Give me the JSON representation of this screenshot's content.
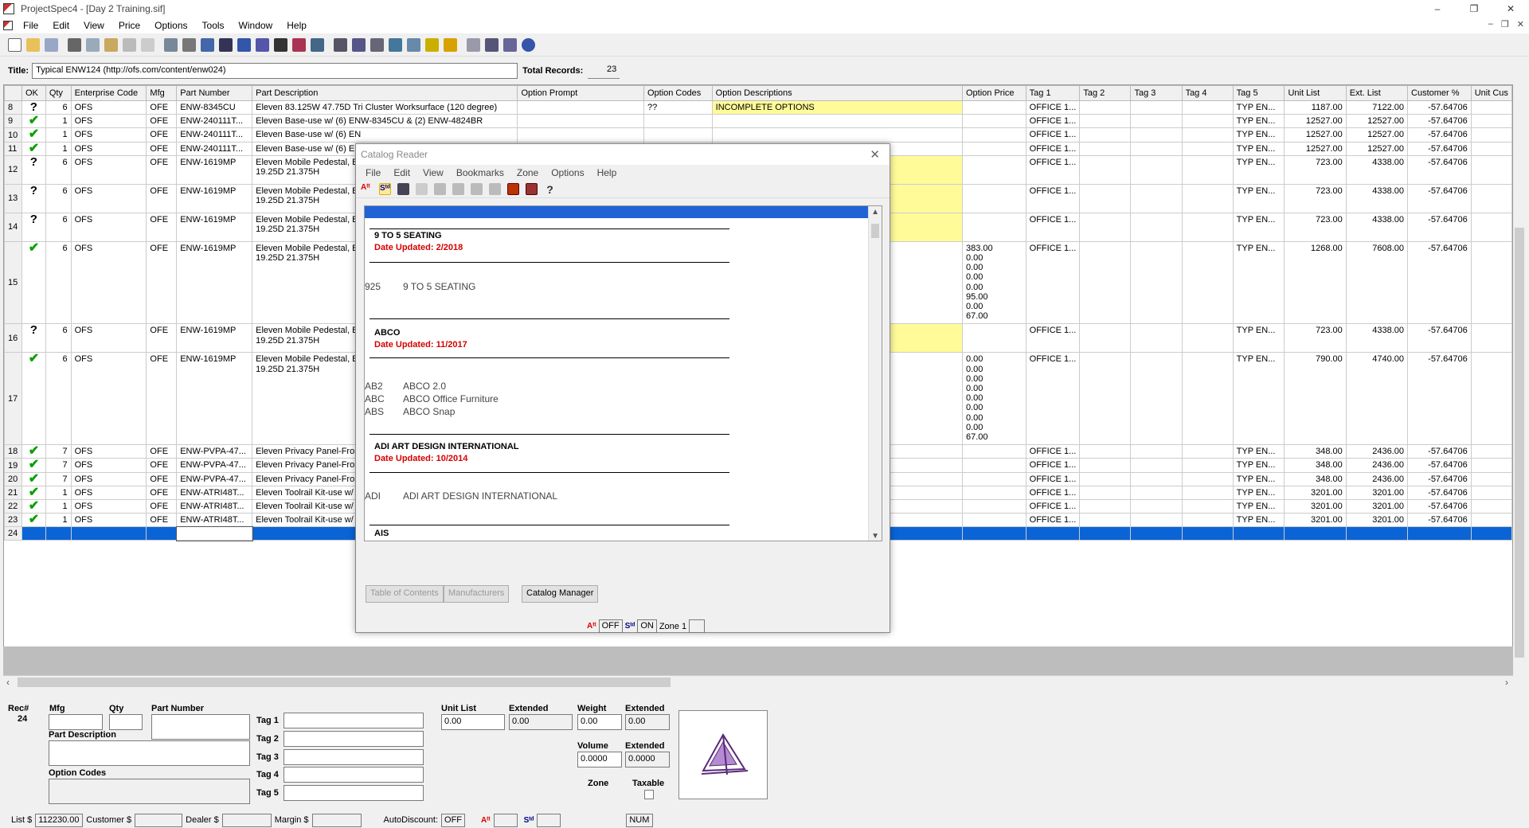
{
  "window": {
    "title": "ProjectSpec4 - [Day 2 Training.sif]",
    "min": "–",
    "restore": "❐",
    "close": "✕"
  },
  "menu": [
    "File",
    "Edit",
    "View",
    "Price",
    "Options",
    "Tools",
    "Window",
    "Help"
  ],
  "mdi_controls": [
    "–",
    "❐",
    "✕"
  ],
  "title_row": {
    "label": "Title:",
    "value": "Typical ENW124  (http://ofs.com/content/enw024)",
    "total_label": "Total Records:",
    "total_value": "23"
  },
  "grid": {
    "columns": [
      "",
      "OK",
      "Qty",
      "Enterprise Code",
      "Mfg",
      "Part Number",
      "Part Description",
      "Option Prompt",
      "Option Codes",
      "Option Descriptions",
      "Option Price",
      "Tag 1",
      "Tag 2",
      "Tag 3",
      "Tag 4",
      "Tag 5",
      "Unit List",
      "Ext. List",
      "Customer %",
      "Unit Cus"
    ],
    "rows": [
      {
        "rec": "8",
        "ok": "?",
        "qty": "6",
        "ent": "OFS",
        "mfg": "OFE",
        "part": "ENW-8345CU",
        "desc": [
          "Eleven 83.125W 47.75D Tri Cluster Worksurface (120 degree)"
        ],
        "prompt": "",
        "codes": "??",
        "optdesc": "INCOMPLETE OPTIONS",
        "price": [],
        "tag1": "OFFICE 1...",
        "tag5": "TYP EN...",
        "unit": "1187.00",
        "ext": "7122.00",
        "cust": "-57.64706",
        "yellow": true
      },
      {
        "rec": "9",
        "ok": "check",
        "qty": "1",
        "ent": "OFS",
        "mfg": "OFE",
        "part": "ENW-240111T...",
        "desc": [
          "Eleven Base-use w/ (6) ENW-8345CU & (2) ENW-4824BR"
        ],
        "prompt": "",
        "codes": "",
        "optdesc": "",
        "price": [],
        "tag1": "OFFICE 1...",
        "tag5": "TYP EN...",
        "unit": "12527.00",
        "ext": "12527.00",
        "cust": "-57.64706",
        "yellow": false
      },
      {
        "rec": "10",
        "ok": "check",
        "qty": "1",
        "ent": "OFS",
        "mfg": "OFE",
        "part": "ENW-240111T...",
        "desc": [
          "Eleven Base-use w/ (6) EN"
        ],
        "prompt": "",
        "codes": "",
        "optdesc": "",
        "price": [],
        "tag1": "OFFICE 1...",
        "tag5": "TYP EN...",
        "unit": "12527.00",
        "ext": "12527.00",
        "cust": "-57.64706",
        "yellow": false
      },
      {
        "rec": "11",
        "ok": "check",
        "qty": "1",
        "ent": "OFS",
        "mfg": "OFE",
        "part": "ENW-240111T...",
        "desc": [
          "Eleven Base-use w/ (6) EN"
        ],
        "prompt": "",
        "codes": "",
        "optdesc": "",
        "price": [],
        "tag1": "OFFICE 1...",
        "tag5": "TYP EN...",
        "unit": "12527.00",
        "ext": "12527.00",
        "cust": "-57.64706",
        "yellow": false
      },
      {
        "rec": "12",
        "ok": "?",
        "qty": "6",
        "ent": "OFS",
        "mfg": "OFE",
        "part": "ENW-1619MP",
        "desc": [
          "Eleven Mobile Pedestal, B",
          "19.25D 21.375H"
        ],
        "prompt": "",
        "codes": "",
        "optdesc": "",
        "price": [],
        "tag1": "OFFICE 1...",
        "tag5": "TYP EN...",
        "unit": "723.00",
        "ext": "4338.00",
        "cust": "-57.64706",
        "yellow": true
      },
      {
        "rec": "13",
        "ok": "?",
        "qty": "6",
        "ent": "OFS",
        "mfg": "OFE",
        "part": "ENW-1619MP",
        "desc": [
          "Eleven Mobile Pedestal, B",
          "19.25D 21.375H"
        ],
        "prompt": "",
        "codes": "",
        "optdesc": "",
        "price": [],
        "tag1": "OFFICE 1...",
        "tag5": "TYP EN...",
        "unit": "723.00",
        "ext": "4338.00",
        "cust": "-57.64706",
        "yellow": true
      },
      {
        "rec": "14",
        "ok": "?",
        "qty": "6",
        "ent": "OFS",
        "mfg": "OFE",
        "part": "ENW-1619MP",
        "desc": [
          "Eleven Mobile Pedestal, B",
          "19.25D 21.375H"
        ],
        "prompt": "",
        "codes": "",
        "optdesc": "",
        "price": [],
        "tag1": "OFFICE 1...",
        "tag5": "TYP EN...",
        "unit": "723.00",
        "ext": "4338.00",
        "cust": "-57.64706",
        "yellow": true
      },
      {
        "rec": "15",
        "ok": "check",
        "qty": "6",
        "ent": "OFS",
        "mfg": "OFE",
        "part": "ENW-1619MP",
        "desc": [
          "Eleven Mobile Pedestal, B",
          "19.25D 21.375H"
        ],
        "prompt": "",
        "codes": "",
        "optdesc": "",
        "price": [
          "383.00",
          "0.00",
          "0.00",
          "0.00",
          "0.00",
          "95.00",
          "0.00",
          "67.00"
        ],
        "tag1": "OFFICE 1...",
        "tag5": "TYP EN...",
        "unit": "1268.00",
        "ext": "7608.00",
        "cust": "-57.64706",
        "yellow": false
      },
      {
        "rec": "16",
        "ok": "?",
        "qty": "6",
        "ent": "OFS",
        "mfg": "OFE",
        "part": "ENW-1619MP",
        "desc": [
          "Eleven Mobile Pedestal, B",
          "19.25D 21.375H"
        ],
        "prompt": "",
        "codes": "",
        "optdesc": "",
        "price": [],
        "tag1": "OFFICE 1...",
        "tag5": "TYP EN...",
        "unit": "723.00",
        "ext": "4338.00",
        "cust": "-57.64706",
        "yellow": true
      },
      {
        "rec": "17",
        "ok": "check",
        "qty": "6",
        "ent": "OFS",
        "mfg": "OFE",
        "part": "ENW-1619MP",
        "desc": [
          "Eleven Mobile Pedestal, B",
          "19.25D 21.375H"
        ],
        "prompt": "",
        "codes": "",
        "optdesc": "",
        "price": [
          "0.00",
          "0.00",
          "0.00",
          "0.00",
          "0.00",
          "0.00",
          "0.00",
          "0.00",
          "67.00"
        ],
        "tag1": "OFFICE 1...",
        "tag5": "TYP EN...",
        "unit": "790.00",
        "ext": "4740.00",
        "cust": "-57.64706",
        "yellow": false
      },
      {
        "rec": "18",
        "ok": "check",
        "qty": "7",
        "ent": "OFS",
        "mfg": "OFE",
        "part": "ENW-PVPA-47...",
        "desc": [
          "Eleven Privacy Panel-Fros"
        ],
        "prompt": "",
        "codes": "",
        "optdesc": "",
        "price": [],
        "tag1": "OFFICE 1...",
        "tag5": "TYP EN...",
        "unit": "348.00",
        "ext": "2436.00",
        "cust": "-57.64706",
        "yellow": false
      },
      {
        "rec": "19",
        "ok": "check",
        "qty": "7",
        "ent": "OFS",
        "mfg": "OFE",
        "part": "ENW-PVPA-47...",
        "desc": [
          "Eleven Privacy Panel-Fros"
        ],
        "prompt": "",
        "codes": "",
        "optdesc": "",
        "price": [],
        "tag1": "OFFICE 1...",
        "tag5": "TYP EN...",
        "unit": "348.00",
        "ext": "2436.00",
        "cust": "-57.64706",
        "yellow": false
      },
      {
        "rec": "20",
        "ok": "check",
        "qty": "7",
        "ent": "OFS",
        "mfg": "OFE",
        "part": "ENW-PVPA-47...",
        "desc": [
          "Eleven Privacy Panel-Fros"
        ],
        "prompt": "",
        "codes": "",
        "optdesc": "",
        "price": [],
        "tag1": "OFFICE 1...",
        "tag5": "TYP EN...",
        "unit": "348.00",
        "ext": "2436.00",
        "cust": "-57.64706",
        "yellow": false
      },
      {
        "rec": "21",
        "ok": "check",
        "qty": "1",
        "ent": "OFS",
        "mfg": "OFE",
        "part": "ENW-ATRI48T...",
        "desc": [
          "Eleven Toolrail Kit-use w/"
        ],
        "prompt": "",
        "codes": "",
        "optdesc": "",
        "price": [],
        "tag1": "OFFICE 1...",
        "tag5": "TYP EN...",
        "unit": "3201.00",
        "ext": "3201.00",
        "cust": "-57.64706",
        "yellow": false
      },
      {
        "rec": "22",
        "ok": "check",
        "qty": "1",
        "ent": "OFS",
        "mfg": "OFE",
        "part": "ENW-ATRI48T...",
        "desc": [
          "Eleven Toolrail Kit-use w/"
        ],
        "prompt": "",
        "codes": "",
        "optdesc": "",
        "price": [],
        "tag1": "OFFICE 1...",
        "tag5": "TYP EN...",
        "unit": "3201.00",
        "ext": "3201.00",
        "cust": "-57.64706",
        "yellow": false
      },
      {
        "rec": "23",
        "ok": "check",
        "qty": "1",
        "ent": "OFS",
        "mfg": "OFE",
        "part": "ENW-ATRI48T...",
        "desc": [
          "Eleven Toolrail Kit-use w/"
        ],
        "prompt": "",
        "codes": "",
        "optdesc": "",
        "price": [],
        "tag1": "OFFICE 1...",
        "tag5": "TYP EN...",
        "unit": "3201.00",
        "ext": "3201.00",
        "cust": "-57.64706",
        "yellow": false
      }
    ],
    "selected_row": "24"
  },
  "detail": {
    "rec_label": "Rec#",
    "rec_value": "24",
    "mfg": "Mfg",
    "qty": "Qty",
    "part_number": "Part Number",
    "part_description": "Part Description",
    "option_codes": "Option Codes",
    "tags": [
      "Tag 1",
      "Tag 2",
      "Tag 3",
      "Tag 4",
      "Tag 5"
    ],
    "unit_list": "Unit List",
    "unit_list_value": "0.00",
    "extended": "Extended",
    "extended_value": "0.00",
    "weight": "Weight",
    "weight_value": "0.00",
    "weight_ext_value": "0.00",
    "volume": "Volume",
    "volume_value": "0.0000",
    "volume_ext_value": "0.0000",
    "zone": "Zone",
    "taxable": "Taxable"
  },
  "status": {
    "list_label": "List $",
    "list_value": "112230.00",
    "customer_label": "Customer $",
    "dealer_label": "Dealer $",
    "margin_label": "Margin $",
    "autodiscount_label": "AutoDiscount:",
    "autodiscount_value": "OFF",
    "num": "NUM"
  },
  "catalog_reader": {
    "title": "Catalog Reader",
    "close": "✕",
    "menu": [
      "File",
      "Edit",
      "View",
      "Bookmarks",
      "Zone",
      "Options",
      "Help"
    ],
    "entries": [
      {
        "section": "9 TO 5 SEATING",
        "updated": "Date Updated: 2/2018",
        "codes": [
          {
            "code": "925",
            "name": "9 TO 5 SEATING"
          }
        ]
      },
      {
        "section": "ABCO",
        "updated": "Date Updated: 11/2017",
        "codes": [
          {
            "code": "AB2",
            "name": "ABCO 2.0"
          },
          {
            "code": "ABC",
            "name": "ABCO Office Furniture"
          },
          {
            "code": "ABS",
            "name": "ABCO Snap"
          }
        ]
      },
      {
        "section": "ADI ART DESIGN INTERNATIONAL",
        "updated": "Date Updated: 10/2014",
        "codes": [
          {
            "code": "ADI",
            "name": "ADI ART DESIGN INTERNATIONAL"
          }
        ]
      },
      {
        "section": "AIS",
        "updated": "",
        "codes": []
      }
    ],
    "buttons": {
      "toc": "Table of Contents",
      "manufacturers": "Manufacturers",
      "catalog_manager": "Catalog Manager"
    },
    "status": {
      "a_value": "OFF",
      "s_value": "ON",
      "zone": "Zone 1"
    }
  }
}
